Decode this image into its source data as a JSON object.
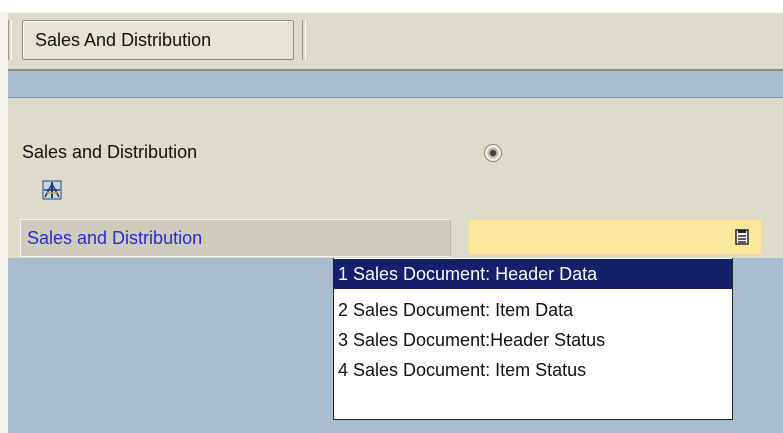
{
  "toolbar": {
    "tab_label": "Sales And Distribution"
  },
  "form": {
    "section_label": "Sales and Distribution",
    "field_label": "Sales and Distribution",
    "input_value": "",
    "tree_icon": "sales-tree-icon",
    "f4_icon": "value-help-icon"
  },
  "dropdown": {
    "selected_index": 0,
    "items": [
      "1 Sales Document: Header Data",
      "2 Sales Document: Item Data",
      "3 Sales Document:Header Status",
      "4 Sales Document: Item Status"
    ]
  },
  "colors": {
    "toolbar_bg": "#dedbcb",
    "band_bg": "#a9bccf",
    "input_bg": "#fbe79c",
    "selection_bg": "#14206b",
    "field_label_color": "#2a2ad8"
  }
}
